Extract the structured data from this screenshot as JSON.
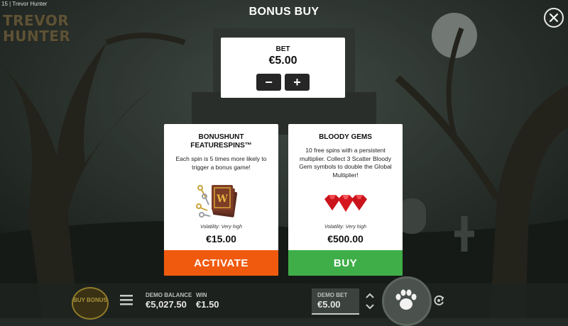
{
  "topbar": {
    "prefix": "15",
    "separator": "|",
    "game_name": "Trevor Hunter"
  },
  "logo": {
    "text": "TREVOR HUNTER"
  },
  "modal": {
    "title": "BONUS BUY",
    "close_icon": "close-x-icon"
  },
  "bet": {
    "label": "BET",
    "value": "€5.00",
    "minus_label": "−",
    "plus_label": "+"
  },
  "cards": [
    {
      "title": "BONUSHUNT FEATURESPINS™",
      "description": "Each spin is 5 times more likely to trigger a bonus game!",
      "art_icon": "keys-and-books-icon",
      "volatility": "Volatility: Very high",
      "price": "€15.00",
      "cta": "ACTIVATE",
      "cta_color": "#f05a0e"
    },
    {
      "title": "BLOODY GEMS",
      "description": "10 free spins with a persistent multiplier. Collect 3 Scatter Bloody Gem symbols to double the Global Multiplier!",
      "art_icon": "red-gems-icon",
      "volatility": "Volatility: Very high",
      "price": "€500.00",
      "cta": "BUY",
      "cta_color": "#3fae48"
    }
  ],
  "bottom_bar": {
    "buy_bonus_label": "BUY BONUS",
    "menu_icon": "hamburger-icon",
    "demo_balance_label": "DEMO BALANCE",
    "demo_balance_value": "€5,027.50",
    "win_label": "WIN",
    "win_value": "€1.50",
    "demo_bet_label": "DEMO BET",
    "demo_bet_value": "€5.00",
    "spin_icon": "paw-icon",
    "autoplay_icon": "autoplay-icon"
  }
}
